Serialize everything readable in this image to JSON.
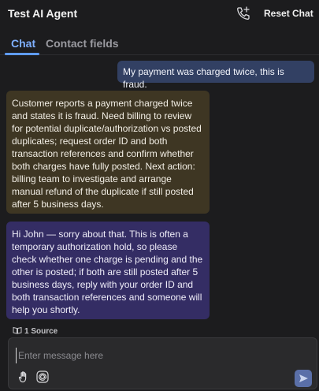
{
  "header": {
    "title": "Test AI Agent",
    "reset_label": "Reset Chat"
  },
  "tabs": [
    {
      "label": "Chat",
      "active": true
    },
    {
      "label": "Contact fields",
      "active": false
    }
  ],
  "messages": {
    "user": "My payment was charged twice, this is fraud.",
    "note": "Customer reports a payment charged twice and states it is fraud. Need billing to review for potential duplicate/authorization vs posted duplicates; request order ID and both transaction references and confirm whether both charges have fully posted. Next action: billing team to investigate and arrange manual refund of the duplicate if still posted after 5 business days.",
    "reply": "Hi John — sorry about that. This is often a temporary authorization hold, so please check whether one charge is pending and the other is posted; if both are still posted after 5 business days, reply with your order ID and both transaction references and someone will help you shortly."
  },
  "source": {
    "label": "1 Source"
  },
  "composer": {
    "placeholder": "Enter message here"
  },
  "colors": {
    "accent": "#5f9cff",
    "user_bubble": "#324063",
    "note_bubble": "#3e3623",
    "reply_bubble": "#342d64",
    "background": "#1c1c1e"
  },
  "icons": [
    "phone-plus-icon",
    "book-icon",
    "hand-icon",
    "at-sign-icon",
    "send-icon"
  ]
}
